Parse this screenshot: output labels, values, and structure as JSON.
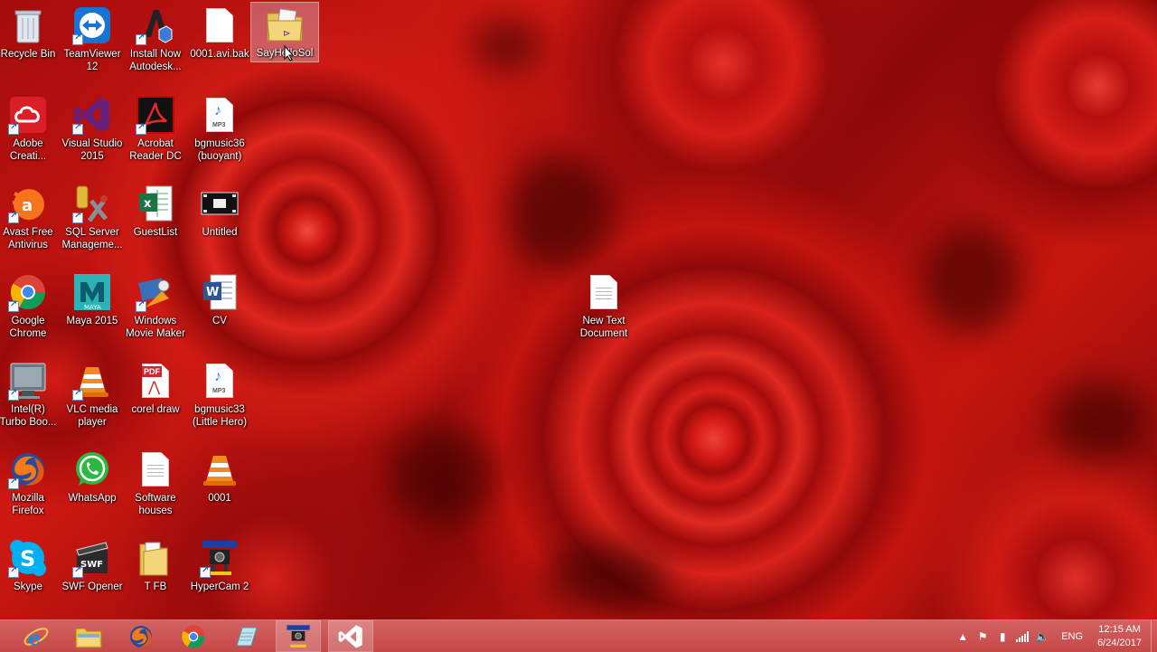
{
  "desktop": {
    "icons": [
      {
        "label": "Recycle Bin",
        "icon": "recycle-bin-icon"
      },
      {
        "label": "TeamViewer\n12",
        "icon": "teamviewer-icon"
      },
      {
        "label": "Install Now\nAutodesk...",
        "icon": "autodesk-installer-icon"
      },
      {
        "label": "0001.avi.bak",
        "icon": "blank-file-icon"
      },
      {
        "label": "SayHelloSol",
        "icon": "folder-icon"
      },
      {
        "label": "Adobe\nCreati...",
        "icon": "adobe-creative-cloud-icon"
      },
      {
        "label": "Visual Studio\n2015",
        "icon": "visual-studio-icon"
      },
      {
        "label": "Acrobat\nReader DC",
        "icon": "acrobat-reader-icon"
      },
      {
        "label": "bgmusic36\n(buoyant)",
        "icon": "mp3-file-icon"
      },
      {
        "label": "Avast Free\nAntivirus",
        "icon": "avast-icon"
      },
      {
        "label": "SQL Server\nManageme...",
        "icon": "sql-server-icon"
      },
      {
        "label": "GuestList",
        "icon": "excel-file-icon"
      },
      {
        "label": "Untitled",
        "icon": "video-file-icon"
      },
      {
        "label": "Google\nChrome",
        "icon": "chrome-icon"
      },
      {
        "label": "Maya 2015",
        "icon": "maya-icon"
      },
      {
        "label": "Windows\nMovie Maker",
        "icon": "movie-maker-icon"
      },
      {
        "label": "CV",
        "icon": "word-file-icon"
      },
      {
        "label": "New Text\nDocument",
        "icon": "text-file-icon"
      },
      {
        "label": "Intel(R)\nTurbo Boo...",
        "icon": "intel-turbo-boost-icon"
      },
      {
        "label": "VLC media\nplayer",
        "icon": "vlc-icon"
      },
      {
        "label": "corel draw",
        "icon": "pdf-file-icon"
      },
      {
        "label": "bgmusic33\n(Little Hero)",
        "icon": "mp3-file-icon"
      },
      {
        "label": "Mozilla\nFirefox",
        "icon": "firefox-icon"
      },
      {
        "label": "WhatsApp",
        "icon": "whatsapp-icon"
      },
      {
        "label": "Software\nhouses",
        "icon": "text-file-icon"
      },
      {
        "label": "0001",
        "icon": "vlc-file-icon"
      },
      {
        "label": "Skype",
        "icon": "skype-icon"
      },
      {
        "label": "SWF Opener",
        "icon": "swf-opener-icon"
      },
      {
        "label": "T FB",
        "icon": "folder-icon"
      },
      {
        "label": "HyperCam 2",
        "icon": "hypercam-icon"
      }
    ]
  },
  "taskbar": {
    "pinned": [
      "internet-explorer-icon",
      "file-explorer-icon",
      "firefox-icon",
      "chrome-icon",
      "notepad-icon",
      "hypercam-icon",
      "visual-studio-icon"
    ],
    "tray": {
      "language": "ENG",
      "time": "12:15 AM",
      "date": "6/24/2017"
    }
  },
  "colors": {
    "taskbar": "#c54848",
    "wallpaper": "#b80d0d"
  }
}
